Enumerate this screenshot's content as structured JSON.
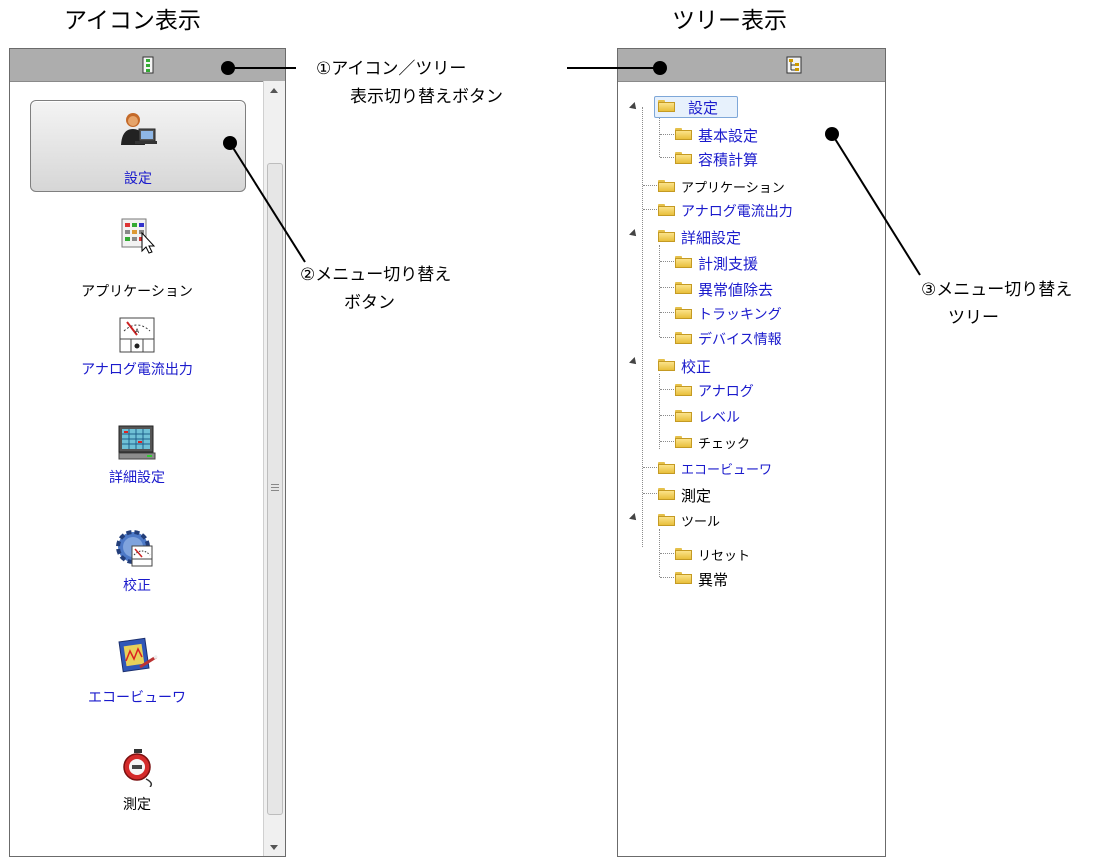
{
  "captions": {
    "icon_view": "アイコン表示",
    "tree_view": "ツリー表示"
  },
  "icon_panel": {
    "items": [
      {
        "label": "設定",
        "icon": "user-laptop-icon",
        "selected": true
      },
      {
        "label": "アプリケーション",
        "icon": "grid-cursor-icon"
      },
      {
        "label": "アナログ電流出力",
        "icon": "meter-icon"
      },
      {
        "label": "詳細設定",
        "icon": "monitor-icon"
      },
      {
        "label": "校正",
        "icon": "gear-meter-icon"
      },
      {
        "label": "エコービューワ",
        "icon": "chart-pen-icon"
      },
      {
        "label": "測定",
        "icon": "stopwatch-icon"
      }
    ]
  },
  "tree_panel": {
    "nodes": [
      {
        "label": "設定",
        "level": 0,
        "expanded": true,
        "selected": true,
        "color": "blue"
      },
      {
        "label": "基本設定",
        "level": 1,
        "color": "blue"
      },
      {
        "label": "容積計算",
        "level": 1,
        "color": "blue"
      },
      {
        "label": "アプリケーション",
        "level": 0,
        "color": "black"
      },
      {
        "label": "アナログ電流出力",
        "level": 0,
        "color": "blue"
      },
      {
        "label": "詳細設定",
        "level": 0,
        "expanded": true,
        "color": "blue"
      },
      {
        "label": "計測支援",
        "level": 1,
        "color": "blue"
      },
      {
        "label": "異常値除去",
        "level": 1,
        "color": "blue"
      },
      {
        "label": "トラッキング",
        "level": 1,
        "color": "blue"
      },
      {
        "label": "デバイス情報",
        "level": 1,
        "color": "blue"
      },
      {
        "label": "校正",
        "level": 0,
        "expanded": true,
        "color": "blue"
      },
      {
        "label": "アナログ",
        "level": 1,
        "color": "blue"
      },
      {
        "label": "レベル",
        "level": 1,
        "color": "blue"
      },
      {
        "label": "チェック",
        "level": 1,
        "color": "black"
      },
      {
        "label": "エコービューワ",
        "level": 0,
        "color": "blue"
      },
      {
        "label": "測定",
        "level": 0,
        "color": "black"
      },
      {
        "label": "ツール",
        "level": 0,
        "expanded": true,
        "color": "black"
      },
      {
        "label": "リセット",
        "level": 1,
        "color": "black"
      },
      {
        "label": "異常",
        "level": 1,
        "color": "black"
      }
    ]
  },
  "callouts": {
    "toggle_line1": "①アイコン／ツリー",
    "toggle_line2": "表示切り替えボタン",
    "menu_button_line1": "②メニュー切り替え",
    "menu_button_line2": "ボタン",
    "menu_tree_line1": "③メニュー切り替え",
    "menu_tree_line2": "ツリー"
  },
  "colors": {
    "link_blue": "#1a1acc",
    "header_gray": "#adadad",
    "selection_blue": "#e7f1fc"
  }
}
